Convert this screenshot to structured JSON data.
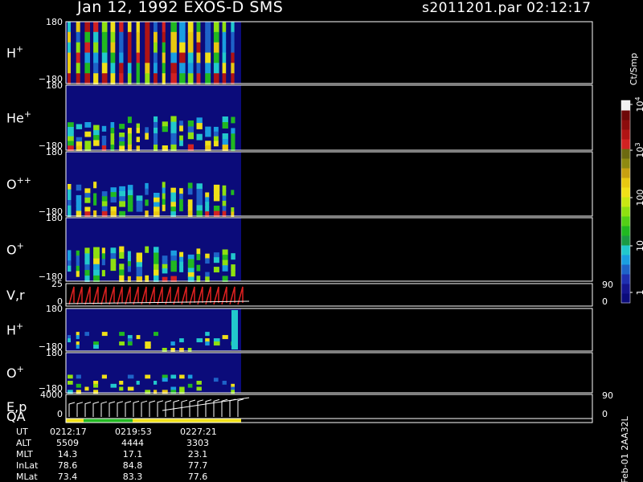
{
  "header": {
    "title": "Jan 12, 1992   EXOS-D SMS",
    "file_time": "s2011201.par  02:12:17"
  },
  "panels": [
    {
      "label": "H",
      "sup": "+",
      "ytop": "180",
      "ybot": "−180",
      "yright_top": "",
      "yright_bot": ""
    },
    {
      "label": "He",
      "sup": "+",
      "ytop": "180",
      "ybot": "−180",
      "yright_top": "",
      "yright_bot": ""
    },
    {
      "label": "O",
      "sup": "++",
      "ytop": "180",
      "ybot": "−180",
      "yright_top": "",
      "yright_bot": ""
    },
    {
      "label": "O",
      "sup": "+",
      "ytop": "180",
      "ybot": "−180",
      "yright_top": "",
      "yright_bot": ""
    },
    {
      "label": "V,r",
      "sup": "",
      "ytop": "25",
      "ybot": "0",
      "yright_top": "90",
      "yright_bot": "0"
    },
    {
      "label": "H",
      "sup": "+",
      "ytop": "180",
      "ybot": "−180",
      "yright_top": "",
      "yright_bot": ""
    },
    {
      "label": "O",
      "sup": "+",
      "ytop": "180",
      "ybot": "−180",
      "yright_top": "",
      "yright_bot": ""
    },
    {
      "label": "E,p",
      "sup": "",
      "ytop": "4000",
      "ybot": "0",
      "yright_top": "90",
      "yright_bot": "0"
    }
  ],
  "qa_label": "QA",
  "colorbar": {
    "unit": "Ct/Smp",
    "ticks": [
      "1",
      "10",
      "100",
      "10",
      "10"
    ],
    "tick_sups": [
      "",
      "",
      "",
      "3",
      "4"
    ],
    "colors": [
      "#0b0b7a",
      "#15158f",
      "#1f2fb0",
      "#1e63c8",
      "#1a9ee0",
      "#22c8cc",
      "#1a9a44",
      "#21b821",
      "#53d016",
      "#8fe010",
      "#c8e812",
      "#f0e018",
      "#e8c810",
      "#c8a010",
      "#8f8a10",
      "#6d6a10",
      "#d22222",
      "#b01414",
      "#8c0c0c",
      "#6e0808",
      "#f2f2f2"
    ]
  },
  "footer": {
    "rows": [
      {
        "label": "UT",
        "values": [
          "0212:17",
          "0219:53",
          "0227:21"
        ]
      },
      {
        "label": "ALT",
        "values": [
          "5509",
          "4444",
          "3303"
        ]
      },
      {
        "label": "MLT",
        "values": [
          "14.3",
          "17.1",
          "23.1"
        ]
      },
      {
        "label": "InLat",
        "values": [
          "78.6",
          "84.8",
          "77.7"
        ]
      },
      {
        "label": "MLat",
        "values": [
          "73.4",
          "83.3",
          "77.6"
        ]
      }
    ],
    "side_text": "Feb-01 2AA32L"
  },
  "chart_data": {
    "type": "heatmap",
    "instrument": "EXOS-D SMS",
    "date": "Jan 12, 1992",
    "time_ticks": [
      "0212:17",
      "0219:53",
      "0227:21"
    ],
    "panels": [
      "H+",
      "He+",
      "O++",
      "O+",
      "V,r",
      "H+",
      "O+",
      "E,p"
    ],
    "y_ranges": [
      [
        -180,
        180
      ],
      [
        -180,
        180
      ],
      [
        -180,
        180
      ],
      [
        -180,
        180
      ],
      [
        0,
        25
      ],
      [
        -180,
        180
      ],
      [
        -180,
        180
      ],
      [
        0,
        4000
      ]
    ],
    "colorbar_scale": "log",
    "colorbar_range": [
      1,
      10000
    ],
    "data_coverage_fraction": 0.3
  }
}
